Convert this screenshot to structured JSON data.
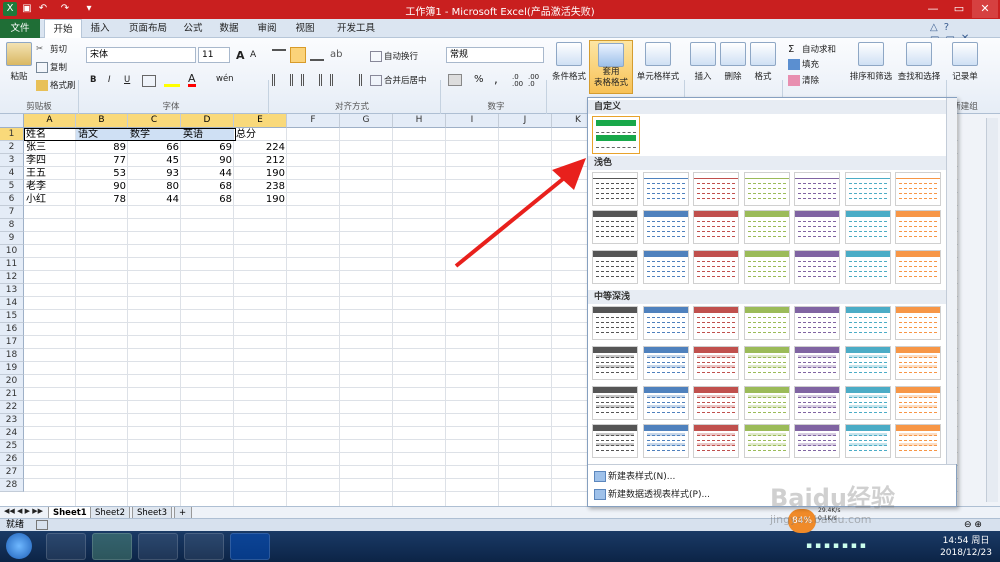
{
  "window": {
    "title": "工作簿1 - Microsoft Excel(产品激活失败)"
  },
  "tabs": [
    "文件",
    "开始",
    "插入",
    "页面布局",
    "公式",
    "数据",
    "审阅",
    "视图",
    "开发工具"
  ],
  "ribbon": {
    "clipboard": {
      "paste": "粘贴",
      "cut": "剪切",
      "copy": "复制",
      "painter": "格式刷",
      "label": "剪贴板"
    },
    "font": {
      "name": "宋体",
      "size": "11",
      "bold": "B",
      "italic": "I",
      "underline": "U",
      "grow": "A",
      "shrink": "A",
      "label": "字体"
    },
    "alignment": {
      "wrap": "自动换行",
      "merge": "合并后居中",
      "label": "对齐方式"
    },
    "number": {
      "format": "常规",
      "percent": "%",
      "comma": ",",
      "label": "数字"
    },
    "styles": {
      "conditional": "条件格式",
      "table_fmt_1": "套用",
      "table_fmt_2": "表格格式",
      "cell_style": "单元格样式"
    },
    "cells": {
      "insert": "插入",
      "delete": "删除",
      "format": "格式"
    },
    "editing": {
      "autosum": "自动求和",
      "fill": "填充",
      "clear": "清除",
      "sort": "排序和筛选",
      "find": "查找和选择"
    },
    "record": {
      "label": "记录单",
      "group": "新建组"
    }
  },
  "columns": [
    "A",
    "B",
    "C",
    "D",
    "E",
    "F",
    "G",
    "H",
    "I",
    "J",
    "K"
  ],
  "rows": [
    "1",
    "2",
    "3",
    "4",
    "5",
    "6",
    "7",
    "8",
    "9",
    "10",
    "11",
    "12",
    "13",
    "14",
    "15",
    "16",
    "17",
    "18",
    "19",
    "20",
    "21",
    "22",
    "23",
    "24",
    "25",
    "26",
    "27",
    "28"
  ],
  "table": {
    "header": [
      "姓名",
      "语文",
      "数学",
      "英语",
      "总分"
    ],
    "data": [
      [
        "张三",
        "89",
        "66",
        "69",
        "224"
      ],
      [
        "李四",
        "77",
        "45",
        "90",
        "212"
      ],
      [
        "王五",
        "53",
        "93",
        "44",
        "190"
      ],
      [
        "老李",
        "90",
        "80",
        "68",
        "238"
      ],
      [
        "小红",
        "78",
        "44",
        "68",
        "190"
      ]
    ]
  },
  "gallery": {
    "custom": "自定义",
    "light": "浅色",
    "medium": "中等深浅",
    "new_table_style": "新建表样式(N)...",
    "new_pivot_style": "新建数据透视表样式(P)...",
    "palette": [
      "#555555",
      "#4f81bd",
      "#c0504d",
      "#9bbb59",
      "#8064a2",
      "#4bacc6",
      "#f79646"
    ]
  },
  "sheets": [
    "Sheet1",
    "Sheet2",
    "Sheet3"
  ],
  "status": {
    "ready": "就绪"
  },
  "taskbar": {
    "time": "14:54 周日",
    "date": "2018/12/23",
    "percent": "84%",
    "speed_up": "29.4K/s",
    "speed_down": "0.1K/s"
  },
  "watermark": {
    "brand": "Baidu经验",
    "url": "jingyan.baidu.com"
  }
}
